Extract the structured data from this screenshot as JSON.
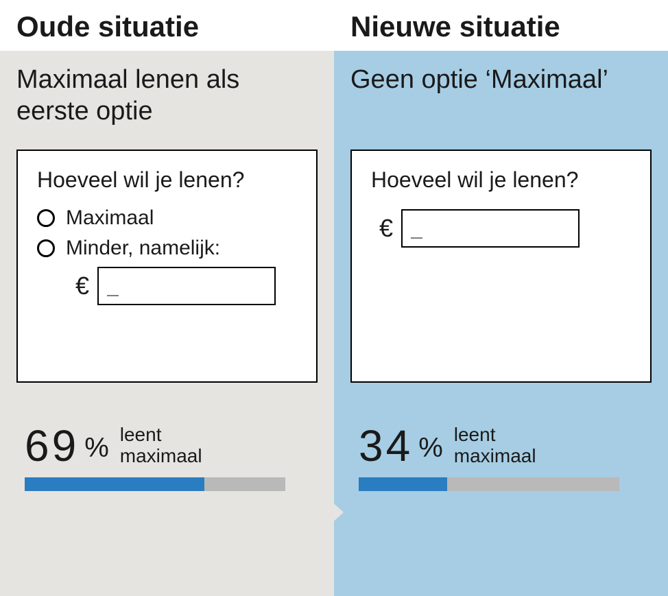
{
  "left": {
    "header": "Oude situatie",
    "subtitle": "Maximaal lenen als eerste optie",
    "mock": {
      "question": "Hoeveel wil je lenen?",
      "option1": "Maximaal",
      "option2": "Minder, namelijk:",
      "euro": "€",
      "placeholder": "_"
    },
    "stat": {
      "value": "69",
      "pct": "%",
      "label_line1": "leent",
      "label_line2": "maximaal",
      "bar_percent": 69
    }
  },
  "right": {
    "header": "Nieuwe situatie",
    "subtitle": "Geen optie ‘Maximaal’",
    "mock": {
      "question": "Hoeveel wil je lenen?",
      "euro": "€",
      "placeholder": "_"
    },
    "stat": {
      "value": "34",
      "pct": "%",
      "label_line1": "leent",
      "label_line2": "maximaal",
      "bar_percent": 34
    }
  },
  "colors": {
    "bar_fill": "#2a7dc0",
    "bar_track": "#b9b9b9",
    "left_bg": "#e6e4e0",
    "right_bg": "#a6cde4"
  },
  "chart_data": [
    {
      "type": "bar",
      "title": "Oude situatie — leent maximaal",
      "categories": [
        "leent maximaal"
      ],
      "values": [
        69
      ],
      "ylim": [
        0,
        100
      ],
      "xlabel": "",
      "ylabel": "%"
    },
    {
      "type": "bar",
      "title": "Nieuwe situatie — leent maximaal",
      "categories": [
        "leent maximaal"
      ],
      "values": [
        34
      ],
      "ylim": [
        0,
        100
      ],
      "xlabel": "",
      "ylabel": "%"
    }
  ]
}
